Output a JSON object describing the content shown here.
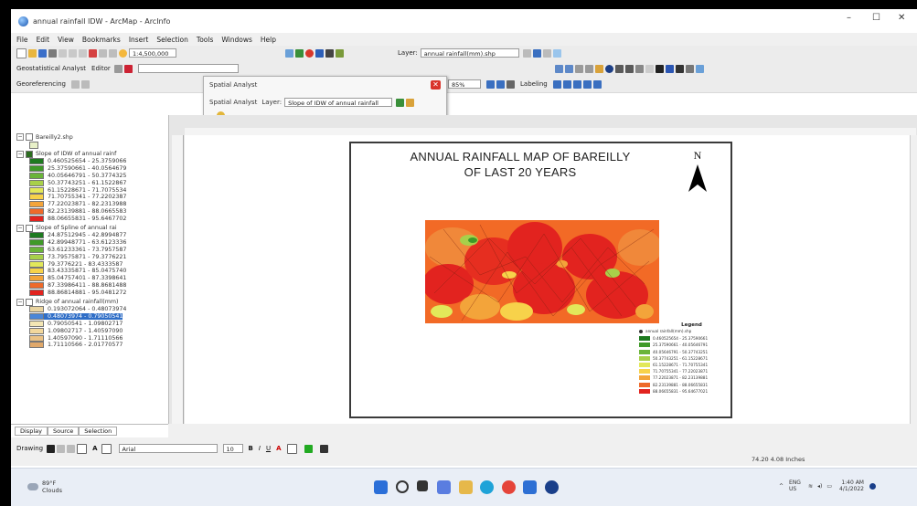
{
  "window": {
    "title": "annual rainfall IDW - ArcMap - ArcInfo",
    "minimize": "–",
    "maximize": "☐",
    "close": "✕"
  },
  "menu": [
    "File",
    "Edit",
    "View",
    "Bookmarks",
    "Insert",
    "Selection",
    "Tools",
    "Windows",
    "Help"
  ],
  "toolbar": {
    "scale": "1:4,500,000",
    "layer_label": "Layer:",
    "layer_value": "annual rainfall(mm).shp",
    "georef_label": "Georeferencing",
    "editor_label": "Editor",
    "geostat_label": "Geostatistical Analyst",
    "spatial_analyst_label": "Spatial Analyst",
    "labeling_label": "Labeling",
    "zoom_value": "85%"
  },
  "popup": {
    "title": "Spatial Analyst",
    "menu_label": "Spatial Analyst",
    "layer_label": "Layer:",
    "layer_value": "Slope of IDW of annual rainfall"
  },
  "toc": {
    "layers": [
      {
        "name": "Bareilly2.shp",
        "expanded": true,
        "checked": false
      },
      {
        "name": "Slope of IDW of annual rainf",
        "expanded": true,
        "checked": true
      },
      {
        "name": "Slope of Spline of annual rai",
        "expanded": true,
        "checked": false
      },
      {
        "name": "Ridge of annual rainfall(mm)",
        "expanded": true,
        "checked": false
      }
    ],
    "idw_classes": [
      {
        "label": "0.460525654 - 25.3759066",
        "color": "#1e7a20"
      },
      {
        "label": "25.37590661 - 40.0564679",
        "color": "#3f9a28"
      },
      {
        "label": "40.05646791 - 50.3774325",
        "color": "#6ab43a"
      },
      {
        "label": "50.37743251 - 61.1522867",
        "color": "#a8d04a"
      },
      {
        "label": "61.15228671 - 71.7075534",
        "color": "#e2e85a"
      },
      {
        "label": "71.70755341 - 77.2202387",
        "color": "#f7d24a"
      },
      {
        "label": "77.22023871 - 82.2313988",
        "color": "#f3a43a"
      },
      {
        "label": "82.23139881 - 88.0665583",
        "color": "#ee6a2a"
      },
      {
        "label": "88.06655831 - 95.6467702",
        "color": "#e2231f"
      }
    ],
    "spline_classes": [
      {
        "label": "24.87512945 - 42.8994877",
        "color": "#1e7a20"
      },
      {
        "label": "42.89948771 - 63.6123336",
        "color": "#3f9a28"
      },
      {
        "label": "63.61233361 - 73.7957587",
        "color": "#6ab43a"
      },
      {
        "label": "73.79575871 - 79.3776221",
        "color": "#a8d04a"
      },
      {
        "label": "79.3776221 - 83.4333587",
        "color": "#e2e85a"
      },
      {
        "label": "83.43335871 - 85.0475740",
        "color": "#f7d24a"
      },
      {
        "label": "85.04757401 - 87.3398641",
        "color": "#f3a43a"
      },
      {
        "label": "87.33986411 - 88.8681488",
        "color": "#ee6a2a"
      },
      {
        "label": "88.86814881 - 95.0481272",
        "color": "#e2231f"
      }
    ],
    "ridge_classes": [
      {
        "label": "0.193072064 - 0.48073974",
        "color": "#e9d4a0",
        "selected": false
      },
      {
        "label": "0.48073974 - 0.79050541",
        "color": "#4a86d8",
        "selected": true
      },
      {
        "label": "0.79050541 - 1.09802717",
        "color": "#f3e6b4",
        "selected": false
      },
      {
        "label": "1.09802717 - 1.40597090",
        "color": "#f2d79c",
        "selected": false
      },
      {
        "label": "1.40597090 - 1.71110566",
        "color": "#ebc285",
        "selected": false
      },
      {
        "label": "1.71110566 - 2.01770577",
        "color": "#e0a86a",
        "selected": false
      }
    ],
    "tabs": [
      "Display",
      "Source",
      "Selection"
    ]
  },
  "layout": {
    "title_line1": "ANNUAL RAINFALL MAP OF BAREILLY",
    "title_line2": "OF LAST 20 YEARS",
    "north_letter": "N",
    "legend_title": "Legend",
    "legend_layer": "annual rainfall(mm).shp",
    "legend_items": [
      {
        "label": "0.460525654 - 25.37590661",
        "color": "#1e7a20"
      },
      {
        "label": "25.37590661 - 40.05646791",
        "color": "#3f9a28"
      },
      {
        "label": "40.05646791 - 50.37743251",
        "color": "#6ab43a"
      },
      {
        "label": "50.37743251 - 61.15228671",
        "color": "#a8d04a"
      },
      {
        "label": "61.15228671 - 71.70755341",
        "color": "#e2e85a"
      },
      {
        "label": "71.70755341 - 77.22023871",
        "color": "#f7d24a"
      },
      {
        "label": "77.22023871 - 82.23139881",
        "color": "#f3a43a"
      },
      {
        "label": "82.23139881 - 88.06655831",
        "color": "#ee6a2a"
      },
      {
        "label": "88.06655831 - 95.64677021",
        "color": "#e2231f"
      }
    ]
  },
  "drawing": {
    "label": "Drawing",
    "font": "Arial",
    "size": "10",
    "bold": "B",
    "italic": "I",
    "underline": "U"
  },
  "status": {
    "coords": "74.20  4.08 Inches"
  },
  "taskbar": {
    "weather_temp": "89°F",
    "weather_text": "Clouds",
    "lang1": "ENG",
    "lang2": "US",
    "time": "1:40 AM",
    "date": "4/1/2022"
  }
}
